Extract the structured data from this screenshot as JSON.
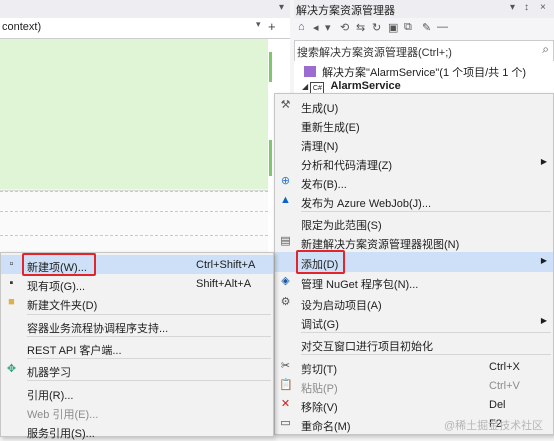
{
  "editor": {
    "context_text": "context)",
    "dropdown_glyph": "▾",
    "add_glyph": "+"
  },
  "solution_explorer": {
    "title": "解决方案资源管理器",
    "title_icons": [
      "▾",
      "↕",
      "×"
    ],
    "toolbar_icons": [
      "home-icon",
      "back-icon",
      "history-icon",
      "sync-icon",
      "refresh-icon",
      "collapse-icon",
      "show-all-icon",
      "settings-wrench-icon",
      "pin-icon"
    ],
    "search_placeholder": "搜索解决方案资源管理器(Ctrl+;)",
    "solution_label": "解决方案\"AlarmService\"(1 个项目/共 1 个)",
    "project_label": "AlarmService",
    "project_badge": "C#"
  },
  "context_menu": {
    "items": [
      {
        "label": "生成(U)",
        "icon": "build-icon"
      },
      {
        "label": "重新生成(E)"
      },
      {
        "label": "清理(N)"
      },
      {
        "label": "分析和代码清理(Z)",
        "submenu": true
      },
      {
        "label": "发布(B)...",
        "icon": "publish-globe-icon"
      },
      {
        "label": "发布为 Azure WebJob(J)...",
        "icon": "azure-icon"
      },
      {
        "label": "限定为此范围(S)"
      },
      {
        "label": "新建解决方案资源管理器视图(N)",
        "icon": "new-view-icon"
      },
      {
        "label": "添加(D)",
        "submenu": true,
        "highlighted": true
      },
      {
        "label": "管理 NuGet 程序包(N)...",
        "icon": "nuget-icon"
      },
      {
        "label": "设为启动项目(A)",
        "icon": "gear-icon"
      },
      {
        "label": "调试(G)",
        "submenu": true
      },
      {
        "label": "对交互窗口进行项目初始化"
      },
      {
        "label": "剪切(T)",
        "icon": "scissors-icon",
        "shortcut": "Ctrl+X"
      },
      {
        "label": "粘贴(P)",
        "icon": "paste-icon",
        "shortcut": "Ctrl+V",
        "disabled": true
      },
      {
        "label": "移除(V)",
        "icon": "delete-x-icon",
        "shortcut": "Del"
      },
      {
        "label": "重命名(M)",
        "icon": "rename-icon",
        "shortcut": "F2"
      }
    ]
  },
  "add_submenu": {
    "items": [
      {
        "label": "新建项(W)...",
        "icon": "new-item-icon",
        "shortcut": "Ctrl+Shift+A",
        "highlighted": true
      },
      {
        "label": "现有项(G)...",
        "icon": "existing-item-icon",
        "shortcut": "Shift+Alt+A"
      },
      {
        "label": "新建文件夹(D)",
        "icon": "folder-icon"
      },
      {
        "label": "容器业务流程协调程序支持..."
      },
      {
        "label": "REST API 客户端..."
      },
      {
        "label": "机器学习",
        "icon": "machine-learning-icon"
      },
      {
        "label": "引用(R)..."
      },
      {
        "label": "Web 引用(E)...",
        "disabled": true
      },
      {
        "label": "服务引用(S)..."
      }
    ]
  },
  "colors": {
    "highlight": "#cde0f7",
    "annotation_red": "#e0252b",
    "diff_green": "#7dc86b"
  },
  "watermark": "@稀土掘金技术社区"
}
